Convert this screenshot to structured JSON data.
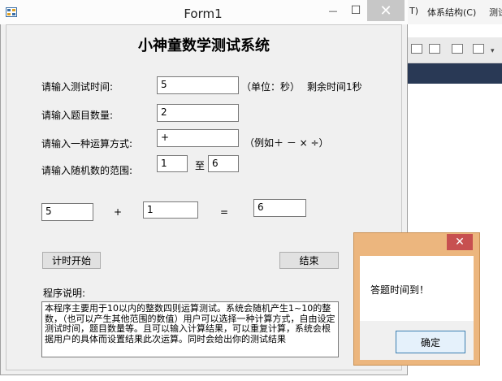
{
  "ide": {
    "menu_items": [
      "T)",
      "体系结构(C)",
      "测试"
    ]
  },
  "form": {
    "title": "Form1",
    "minimize_glyph": "—",
    "maximize_glyph": "☐",
    "close_glyph": "✕",
    "heading": "小神童数学测试系统",
    "time_label": "请输入测试时间:",
    "time_value": "5",
    "time_unit": "（单位：秒）",
    "remaining": "剩余时间1秒",
    "count_label": "请输入题目数量:",
    "count_value": "2",
    "op_label": "请输入一种运算方式:",
    "op_value": "+",
    "op_example": "（例如＋ － × ÷）",
    "range_label": "请输入随机数的范围:",
    "range_min": "1",
    "range_to": "至",
    "range_max": "6",
    "operand1": "5",
    "operator": "+",
    "operand2": "1",
    "equals": "=",
    "answer": "6",
    "start_button": "计时开始",
    "end_button": "结束",
    "desc_label": "程序说明:",
    "description": "本程序主要用于10以内的整数四则运算测试。系统会随机产生1~10的整数，（也可以产生其他范围的数值）用户可以选择一种计算方式，自由设定测试时间，题目数量等。且可以输入计算结果，可以重复计算，系统会根据用户的具体而设置结果此次运算。同时会给出你的测试结果"
  },
  "messagebox": {
    "close_glyph": "✕",
    "text": "答题时间到！",
    "ok_label": "确定"
  }
}
